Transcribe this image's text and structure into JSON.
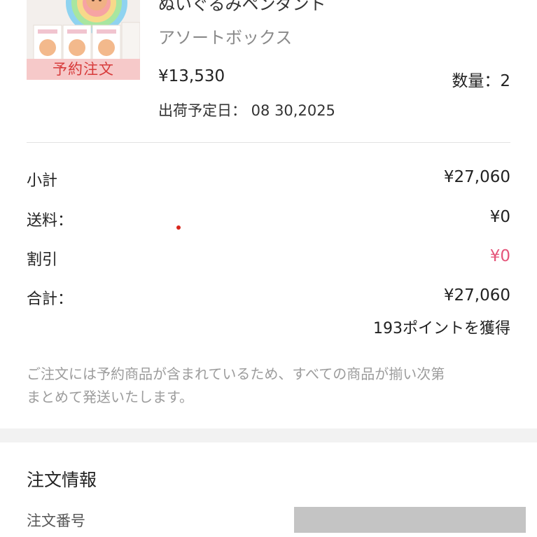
{
  "product": {
    "badge": "予約注文",
    "name": "ぬいぐるみペンダント",
    "variant": "アソートボックス",
    "unit_price": "¥13,530",
    "quantity": "数量：2",
    "ship_date": "出荷予定日： 08 30,2025"
  },
  "summary": {
    "subtotal_label": "小計",
    "subtotal_value": "¥27,060",
    "shipping_label": "送料：",
    "shipping_value": "¥0",
    "discount_label": "割引",
    "discount_value": "¥0",
    "total_label": "合計：",
    "total_value": "¥27,060",
    "points": "193ポイントを獲得"
  },
  "notice": {
    "line1": "ご注文には予約商品が含まれているため、すべての商品が揃い次第",
    "line2": "まとめて発送いたします。"
  },
  "order_info": {
    "title": "注文情報",
    "order_number_label": "注文番号"
  },
  "colors": {
    "discount": "#e5557a",
    "badge_bg": "#f6c9c9",
    "badge_text": "#d73a3a",
    "notice_text": "#9c9c9c"
  }
}
